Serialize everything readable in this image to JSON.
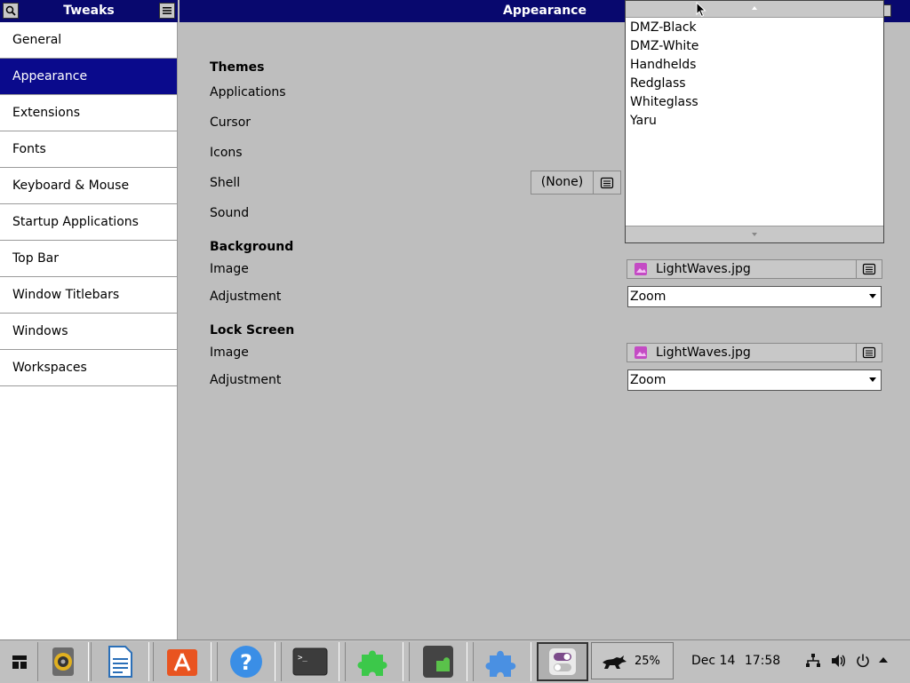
{
  "sidebar": {
    "title": "Tweaks",
    "items": [
      {
        "label": "General"
      },
      {
        "label": "Appearance"
      },
      {
        "label": "Extensions"
      },
      {
        "label": "Fonts"
      },
      {
        "label": "Keyboard & Mouse"
      },
      {
        "label": "Startup Applications"
      },
      {
        "label": "Top Bar"
      },
      {
        "label": "Window Titlebars"
      },
      {
        "label": "Windows"
      },
      {
        "label": "Workspaces"
      }
    ],
    "active_index": 1
  },
  "main": {
    "title": "Appearance",
    "themes": {
      "heading": "Themes",
      "applications": "Applications",
      "cursor": "Cursor",
      "icons": "Icons",
      "shell": "Shell",
      "shell_value": "(None)",
      "sound": "Sound"
    },
    "background": {
      "heading": "Background",
      "image_label": "Image",
      "image_value": "LightWaves.jpg",
      "adjustment_label": "Adjustment",
      "adjustment_value": "Zoom"
    },
    "lock_screen": {
      "heading": "Lock Screen",
      "image_label": "Image",
      "image_value": "LightWaves.jpg",
      "adjustment_label": "Adjustment",
      "adjustment_value": "Zoom"
    }
  },
  "popup_list": {
    "items": [
      "DMZ-Black",
      "DMZ-White",
      "Handhelds",
      "Redglass",
      "Whiteglass",
      "Yaru"
    ]
  },
  "taskbar": {
    "battery_percent": "25%",
    "date": "Dec 14",
    "time": "17:58"
  },
  "colors": {
    "header_bg": "#08086e",
    "selected_bg": "#0a0a8c",
    "window_bg": "#bebebe"
  }
}
